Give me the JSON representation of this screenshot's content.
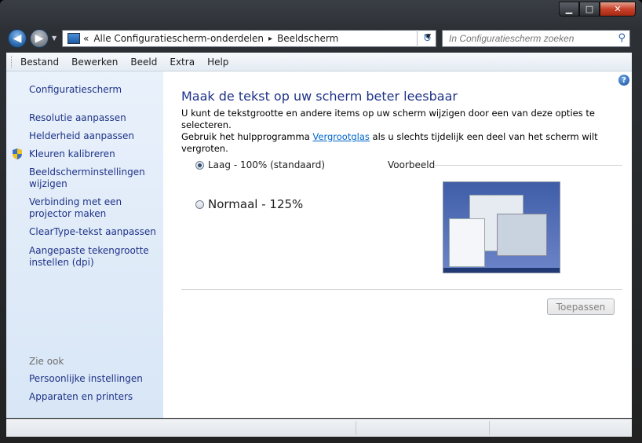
{
  "window": {
    "controls": {
      "minimize": "▁",
      "maximize": "□",
      "close": "✕"
    }
  },
  "address_bar": {
    "prefix": "«",
    "segments": [
      "Alle Configuratiescherm-onderdelen",
      "Beeldscherm"
    ],
    "separator": "▸"
  },
  "search": {
    "placeholder": "In Configuratiescherm zoeken"
  },
  "menu": [
    "Bestand",
    "Bewerken",
    "Beeld",
    "Extra",
    "Help"
  ],
  "sidebar": {
    "home": "Configuratiescherm",
    "items": [
      "Resolutie aanpassen",
      "Helderheid aanpassen",
      "Kleuren kalibreren",
      "Beeldscherminstellingen wijzigen",
      "Verbinding met een projector maken",
      "ClearType-tekst aanpassen",
      "Aangepaste tekengrootte instellen (dpi)"
    ],
    "see_also_title": "Zie ook",
    "see_also": [
      "Persoonlijke instellingen",
      "Apparaten en printers"
    ]
  },
  "main": {
    "title": "Maak de tekst op uw scherm beter leesbaar",
    "desc_line1": "U kunt de tekstgrootte en andere items op uw scherm wijzigen door een van deze opties te selecteren.",
    "desc_line2_pre": "Gebruik het hulpprogramma ",
    "desc_link": "Vergrootglas",
    "desc_line2_post": " als u slechts tijdelijk een deel van het scherm wilt vergroten.",
    "options": [
      {
        "label": "Laag - 100% (standaard)",
        "selected": true
      },
      {
        "label": "Normaal - 125%",
        "selected": false
      }
    ],
    "preview_label": "Voorbeeld",
    "apply_label": "Toepassen"
  },
  "colors": {
    "link": "#1e3287",
    "sidebar_bg": "#e9f1fb"
  }
}
